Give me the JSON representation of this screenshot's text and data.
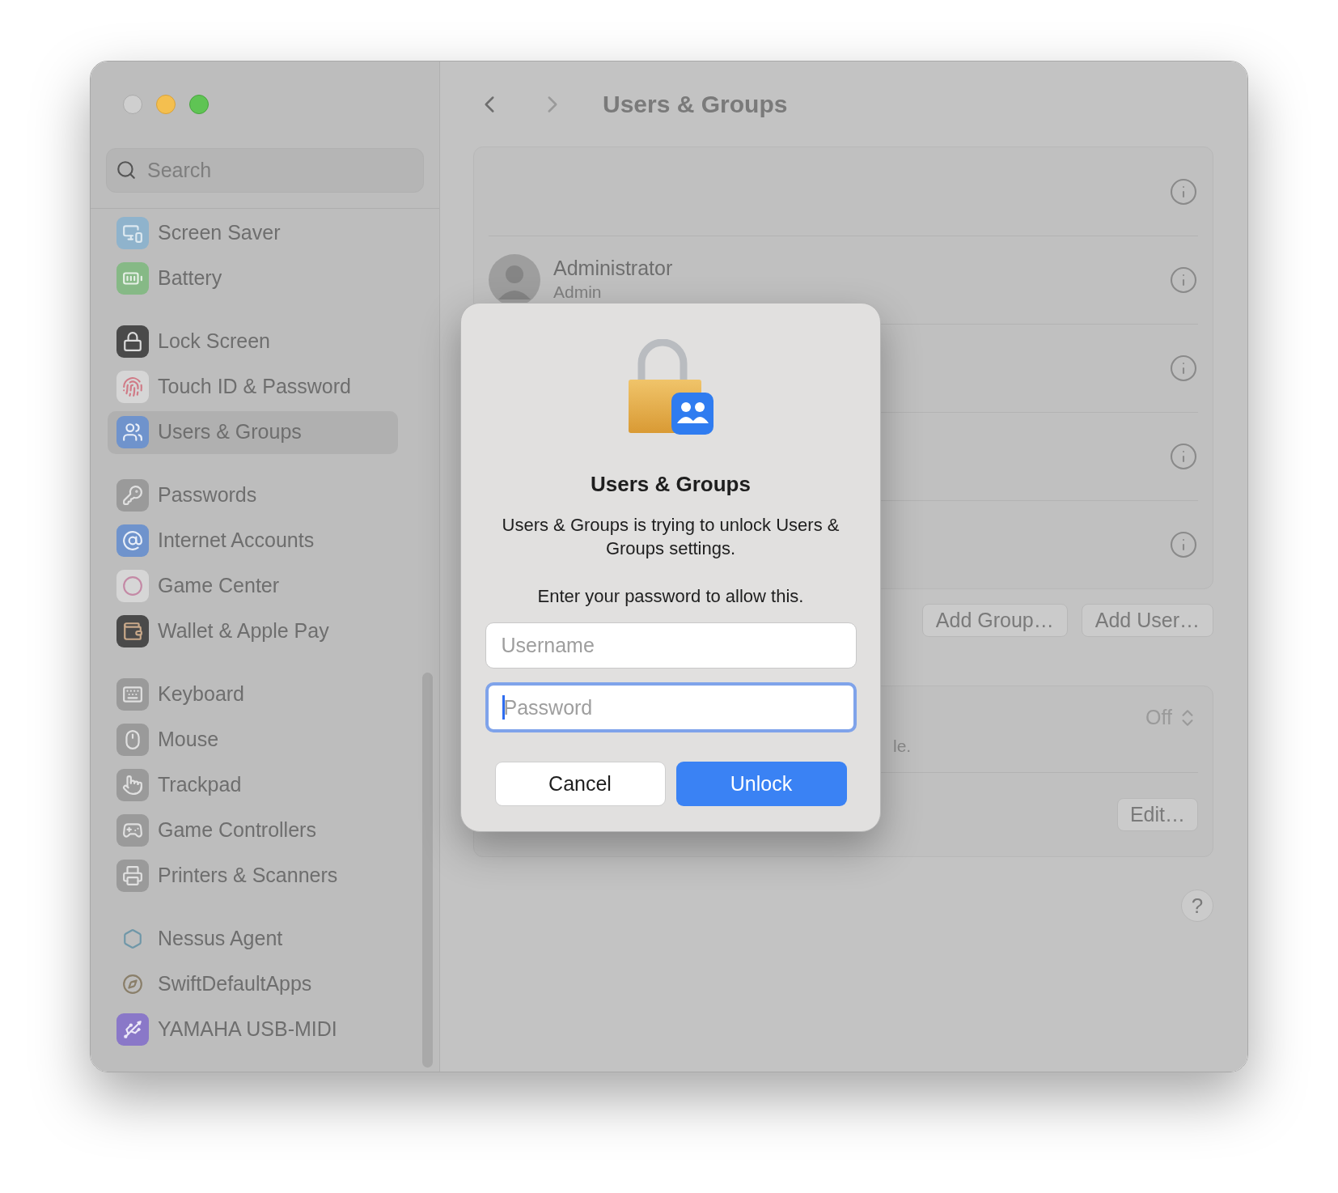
{
  "sidebar": {
    "search": {
      "placeholder": "Search"
    },
    "groups": [
      {
        "items": [
          {
            "label": "Screen Saver",
            "selected": false
          },
          {
            "label": "Battery",
            "selected": false
          }
        ]
      },
      {
        "items": [
          {
            "label": "Lock Screen",
            "selected": false
          },
          {
            "label": "Touch ID & Password",
            "selected": false
          },
          {
            "label": "Users & Groups",
            "selected": true
          }
        ]
      },
      {
        "items": [
          {
            "label": "Passwords",
            "selected": false
          },
          {
            "label": "Internet Accounts",
            "selected": false
          },
          {
            "label": "Game Center",
            "selected": false
          },
          {
            "label": "Wallet & Apple Pay",
            "selected": false
          }
        ]
      },
      {
        "items": [
          {
            "label": "Keyboard",
            "selected": false
          },
          {
            "label": "Mouse",
            "selected": false
          },
          {
            "label": "Trackpad",
            "selected": false
          },
          {
            "label": "Game Controllers",
            "selected": false
          },
          {
            "label": "Printers & Scanners",
            "selected": false
          }
        ]
      },
      {
        "items": [
          {
            "label": "Nessus Agent",
            "selected": false
          },
          {
            "label": "SwiftDefaultApps",
            "selected": false
          },
          {
            "label": "YAMAHA USB-MIDI",
            "selected": false
          }
        ]
      }
    ]
  },
  "main": {
    "title": "Users & Groups",
    "rows": [
      {
        "kind": "blank"
      },
      {
        "kind": "user",
        "name": "Administrator",
        "role": "Admin"
      },
      {
        "kind": "blank"
      },
      {
        "kind": "blank"
      },
      {
        "kind": "blank"
      }
    ],
    "buttons": [
      "Add Group…",
      "Add User…"
    ],
    "settings": {
      "popup_value": "Off",
      "description": "le.",
      "edit_button": "Edit…"
    },
    "help_button": "?"
  },
  "dialog": {
    "title": "Users & Groups",
    "message": "Users & Groups is trying to unlock Users & Groups settings.",
    "prompt": "Enter your password to allow this.",
    "username": {
      "placeholder": "Username",
      "focused": false
    },
    "password": {
      "placeholder": "Password",
      "focused": true
    },
    "buttons": [
      {
        "label": "Cancel",
        "kind": "secondary"
      },
      {
        "label": "Unlock",
        "kind": "primary"
      }
    ]
  }
}
